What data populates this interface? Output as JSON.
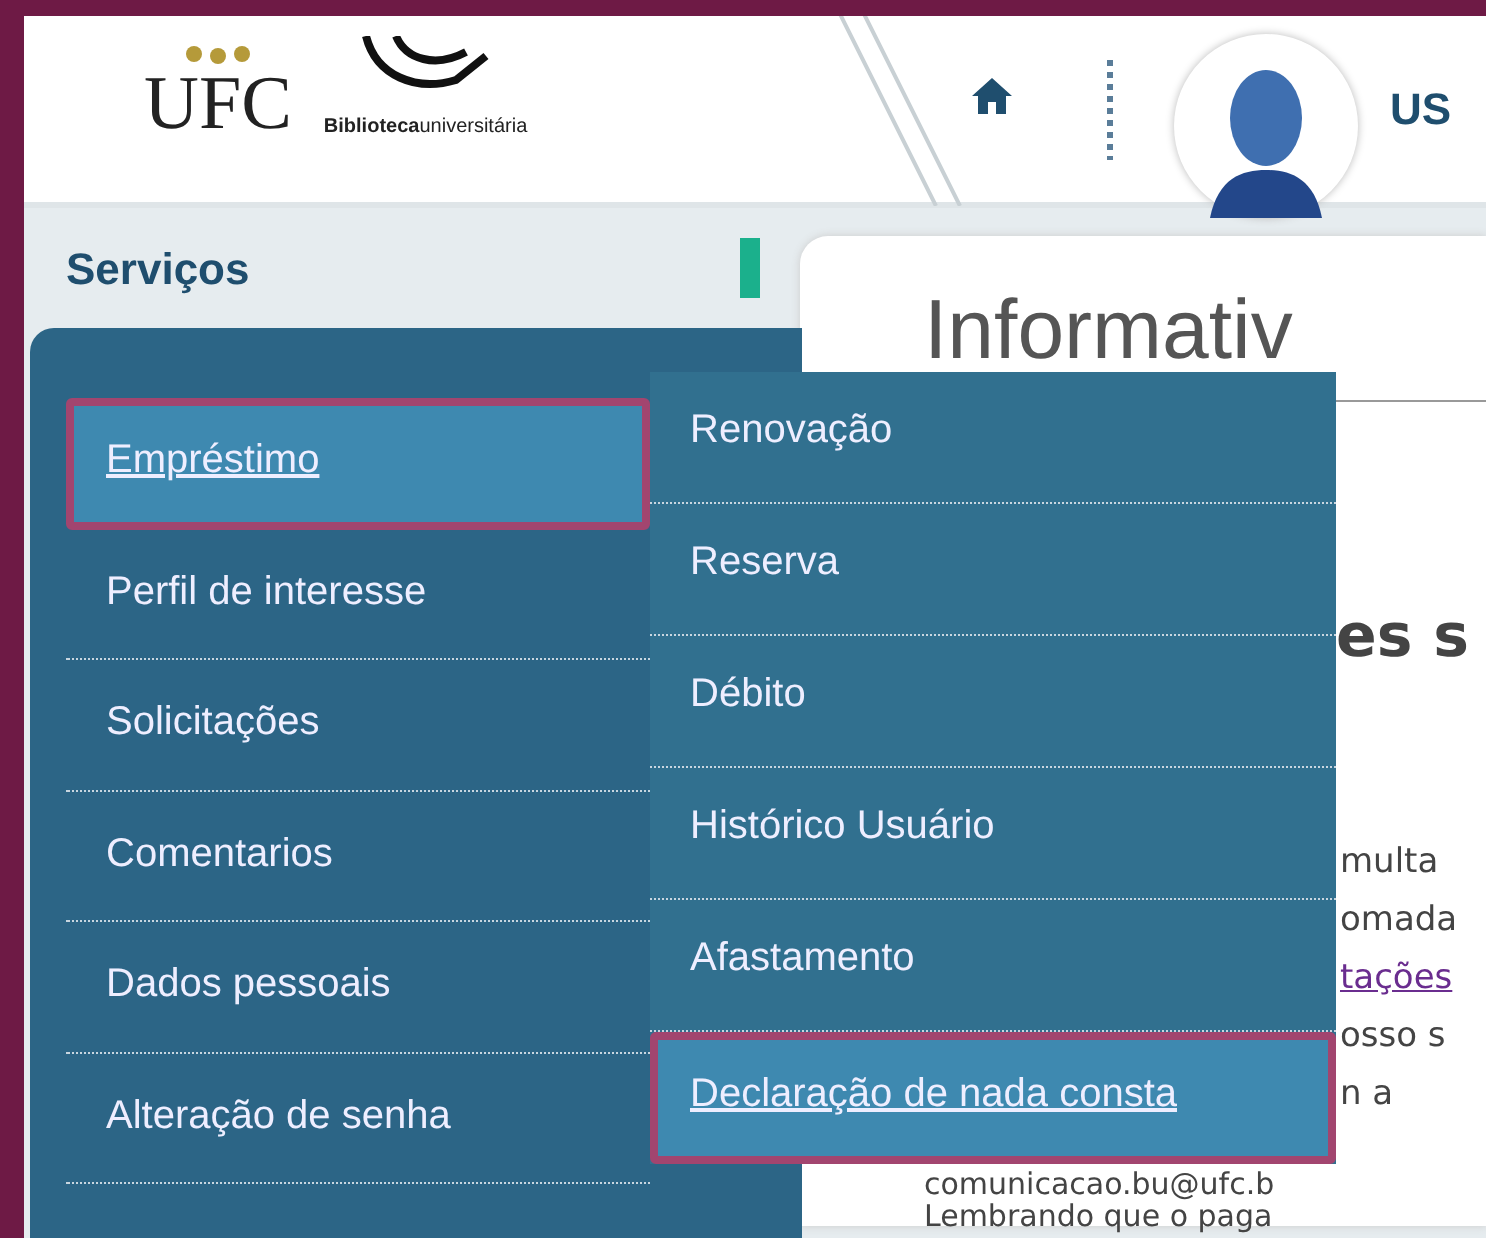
{
  "header": {
    "logo_text": "UFC",
    "library_brand": "**Biblioteca**universitária",
    "user_name": "US"
  },
  "sidebar": {
    "title": "Serviços",
    "items": [
      {
        "label": "Empréstimo",
        "selected": true,
        "highlighted": true
      },
      {
        "label": "Perfil de interesse",
        "selected": false,
        "highlighted": false
      },
      {
        "label": "Solicitações",
        "selected": false,
        "highlighted": false
      },
      {
        "label": "Comentarios",
        "selected": false,
        "highlighted": false
      },
      {
        "label": "Dados pessoais",
        "selected": false,
        "highlighted": false
      },
      {
        "label": "Alteração de senha",
        "selected": false,
        "highlighted": false
      }
    ],
    "submenu": [
      {
        "label": "Renovação",
        "selected": false,
        "highlighted": false
      },
      {
        "label": "Reserva",
        "selected": false,
        "highlighted": false
      },
      {
        "label": "Débito",
        "selected": false,
        "highlighted": false
      },
      {
        "label": "Histórico Usuário",
        "selected": false,
        "highlighted": false
      },
      {
        "label": "Afastamento",
        "selected": false,
        "highlighted": false
      },
      {
        "label": "Declaração de nada consta",
        "selected": true,
        "highlighted": true
      }
    ]
  },
  "content": {
    "title": "Informativ",
    "heading_fragment": "es s",
    "lines": [
      {
        "kind": "fragment",
        "text": "multa"
      },
      {
        "kind": "fragment",
        "text": "omada"
      },
      {
        "kind": "link",
        "text": "tações"
      },
      {
        "kind": "fragment",
        "text": "osso s"
      },
      {
        "kind": "fragment",
        "text": "n a"
      },
      {
        "kind": "full",
        "text": "comunicacao.bu@ufc.b"
      },
      {
        "kind": "full",
        "text": "Lembrando que o paga"
      }
    ]
  }
}
